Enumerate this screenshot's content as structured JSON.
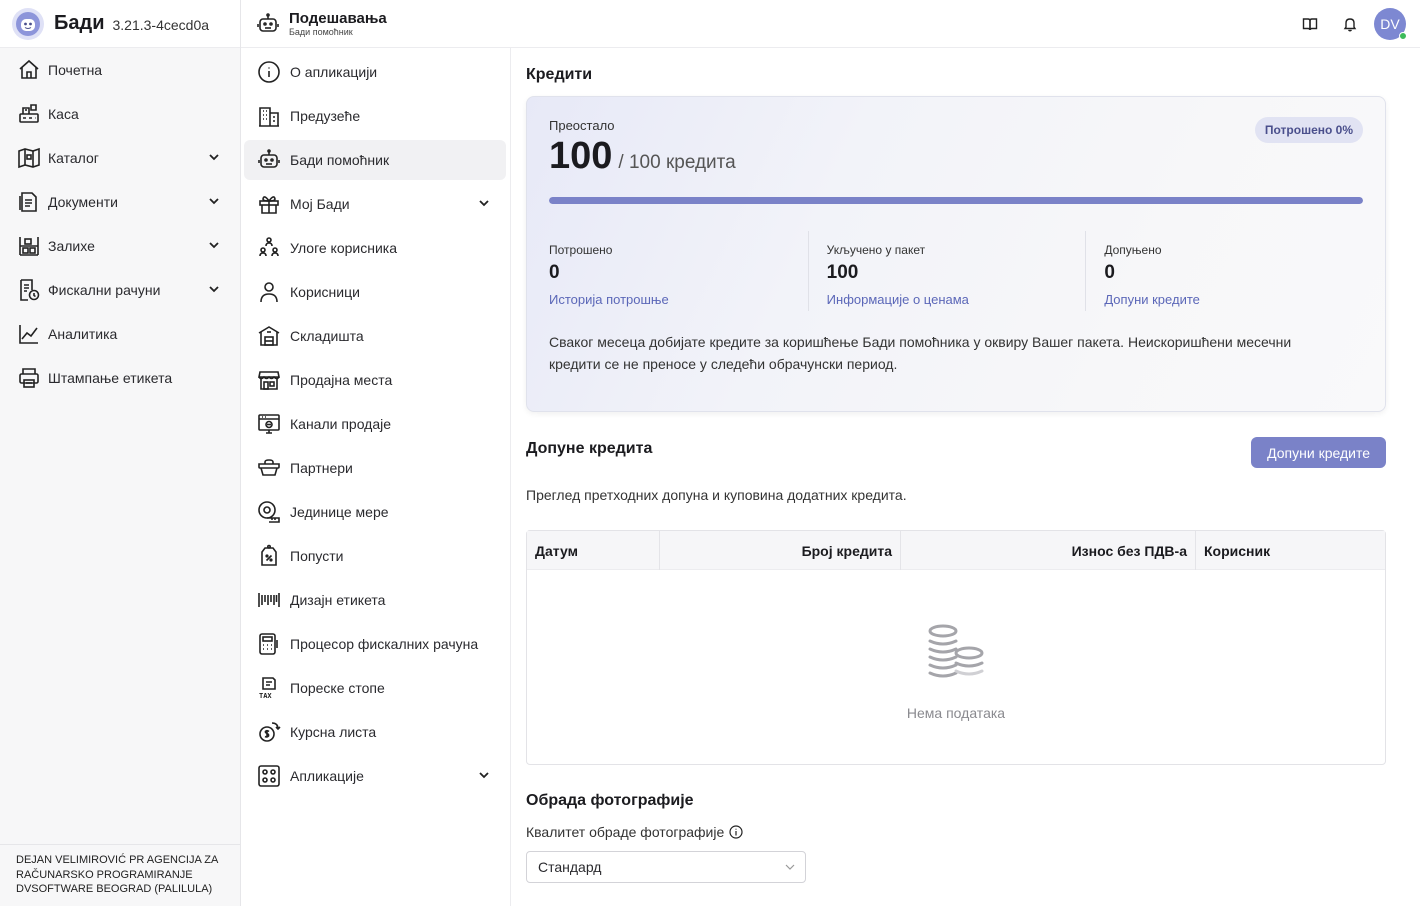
{
  "app": {
    "name": "Бади",
    "version": "3.21.3-4cecd0a"
  },
  "sidebar": {
    "items": [
      {
        "label": "Почетна",
        "icon": "home-icon",
        "expandable": false
      },
      {
        "label": "Каса",
        "icon": "cash-register-icon",
        "expandable": false
      },
      {
        "label": "Каталог",
        "icon": "catalog-icon",
        "expandable": true
      },
      {
        "label": "Документи",
        "icon": "documents-icon",
        "expandable": true
      },
      {
        "label": "Залихе",
        "icon": "inventory-icon",
        "expandable": true
      },
      {
        "label": "Фискални рачуни",
        "icon": "fiscal-receipt-icon",
        "expandable": true
      },
      {
        "label": "Аналитика",
        "icon": "analytics-icon",
        "expandable": false
      },
      {
        "label": "Штампање етикета",
        "icon": "printer-icon",
        "expandable": false
      }
    ],
    "company": "DEJAN VELIMIROVIĆ PR AGENCIJA ZA RAČUNARSKO PROGRAMIRANJE DVSOFTWARE BEOGRAD (PALILULA)"
  },
  "header": {
    "title": "Подешавања",
    "subtitle": "Бади помоћник"
  },
  "settings_menu": [
    {
      "label": "О апликацији",
      "icon": "info-icon",
      "active": false,
      "expandable": false
    },
    {
      "label": "Предузеће",
      "icon": "building-icon",
      "active": false,
      "expandable": false
    },
    {
      "label": "Бади помоћник",
      "icon": "robot-icon",
      "active": true,
      "expandable": false
    },
    {
      "label": "Мој Бади",
      "icon": "gift-icon",
      "active": false,
      "expandable": true
    },
    {
      "label": "Улоге корисника",
      "icon": "user-roles-icon",
      "active": false,
      "expandable": false
    },
    {
      "label": "Корисници",
      "icon": "user-icon",
      "active": false,
      "expandable": false
    },
    {
      "label": "Складишта",
      "icon": "warehouse-icon",
      "active": false,
      "expandable": false
    },
    {
      "label": "Продајна места",
      "icon": "store-icon",
      "active": false,
      "expandable": false
    },
    {
      "label": "Канали продаје",
      "icon": "sales-channel-icon",
      "active": false,
      "expandable": false
    },
    {
      "label": "Партнери",
      "icon": "partners-icon",
      "active": false,
      "expandable": false
    },
    {
      "label": "Јединице мере",
      "icon": "measure-tape-icon",
      "active": false,
      "expandable": false
    },
    {
      "label": "Попусти",
      "icon": "discount-tag-icon",
      "active": false,
      "expandable": false
    },
    {
      "label": "Дизајн етикета",
      "icon": "barcode-icon",
      "active": false,
      "expandable": false
    },
    {
      "label": "Процесор фискалних рачуна",
      "icon": "calculator-icon",
      "active": false,
      "expandable": false
    },
    {
      "label": "Пореске стопе",
      "icon": "tax-icon",
      "active": false,
      "expandable": false
    },
    {
      "label": "Курсна листа",
      "icon": "exchange-icon",
      "active": false,
      "expandable": false
    },
    {
      "label": "Апликације",
      "icon": "apps-icon",
      "active": false,
      "expandable": true
    }
  ],
  "credits": {
    "section_title": "Кредити",
    "remaining_label": "Преостало",
    "remaining": "100",
    "total_text": "/ 100 кредита",
    "used_badge": "Потрошено 0%",
    "used_fraction": 0,
    "stats": [
      {
        "label": "Потрошено",
        "value": "0",
        "link": "Историја потрошње"
      },
      {
        "label": "Укључено у пакет",
        "value": "100",
        "link": "Информације о ценама"
      },
      {
        "label": "Допуњено",
        "value": "0",
        "link": "Допуни кредите"
      }
    ],
    "note": "Сваког месеца добијате кредите за коришћење Бади помоћника у оквиру Вашег пакета. Неискоришћени месечни кредити се не преносе у следећи обрачунски период."
  },
  "topups": {
    "title": "Допуне кредита",
    "button": "Допуни кредите",
    "description": "Преглед претходних допуна и куповина додатних кредита.",
    "columns": [
      "Датум",
      "Број кредита",
      "Износ без ПДВ-а",
      "Корисник"
    ],
    "empty_text": "Нема података"
  },
  "photo": {
    "title": "Обрада фотографије",
    "quality_label": "Квалитет обраде фотографије",
    "quality_value": "Стандард"
  },
  "user": {
    "initials": "DV"
  },
  "colors": {
    "accent": "#7a82c8",
    "link": "#5b67b8",
    "online": "#3dbb5a"
  }
}
